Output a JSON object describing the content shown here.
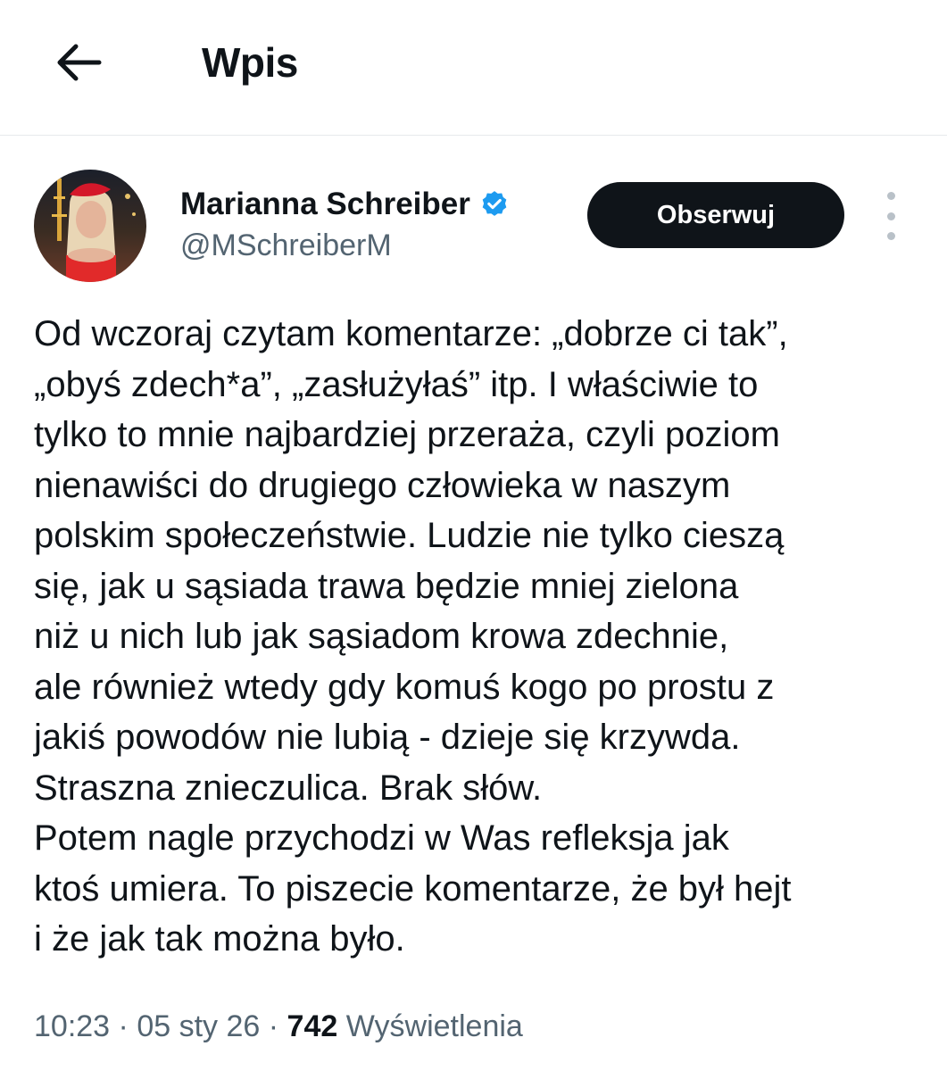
{
  "header": {
    "title": "Wpis"
  },
  "author": {
    "display_name": "Marianna Schreiber",
    "handle": "@MSchreiberM",
    "verified": true,
    "verified_color": "#1d9bf0"
  },
  "follow_button": {
    "label": "Obserwuj"
  },
  "tweet": {
    "lines": [
      "Od wczoraj czytam komentarze: „dobrze ci tak”,",
      "„obyś zdech*a”, „zasłużyłaś” itp. I właściwie to",
      "tylko to mnie najbardziej przeraża, czyli poziom",
      "nienawiści do drugiego człowieka w naszym",
      "polskim społeczeństwie. Ludzie nie tylko cieszą",
      "się, jak u sąsiada trawa będzie mniej zielona",
      "niż u nich lub jak sąsiadom krowa zdechnie,",
      "ale również wtedy gdy komuś kogo po prostu z",
      "jakiś powodów nie lubią - dzieje się krzywda.",
      "Straszna znieczulica. Brak słów.",
      "Potem nagle przychodzi w Was refleksja jak",
      "ktoś umiera. To piszecie komentarze, że był hejt",
      "i że jak tak można było."
    ]
  },
  "meta": {
    "time": "10:23",
    "separator": "·",
    "date": "05 sty 26",
    "views_count": "742",
    "views_label": "Wyświetlenia"
  },
  "icons": {
    "back": "arrow-left-icon",
    "verified": "verified-badge-icon",
    "more": "more-vertical-icon"
  }
}
